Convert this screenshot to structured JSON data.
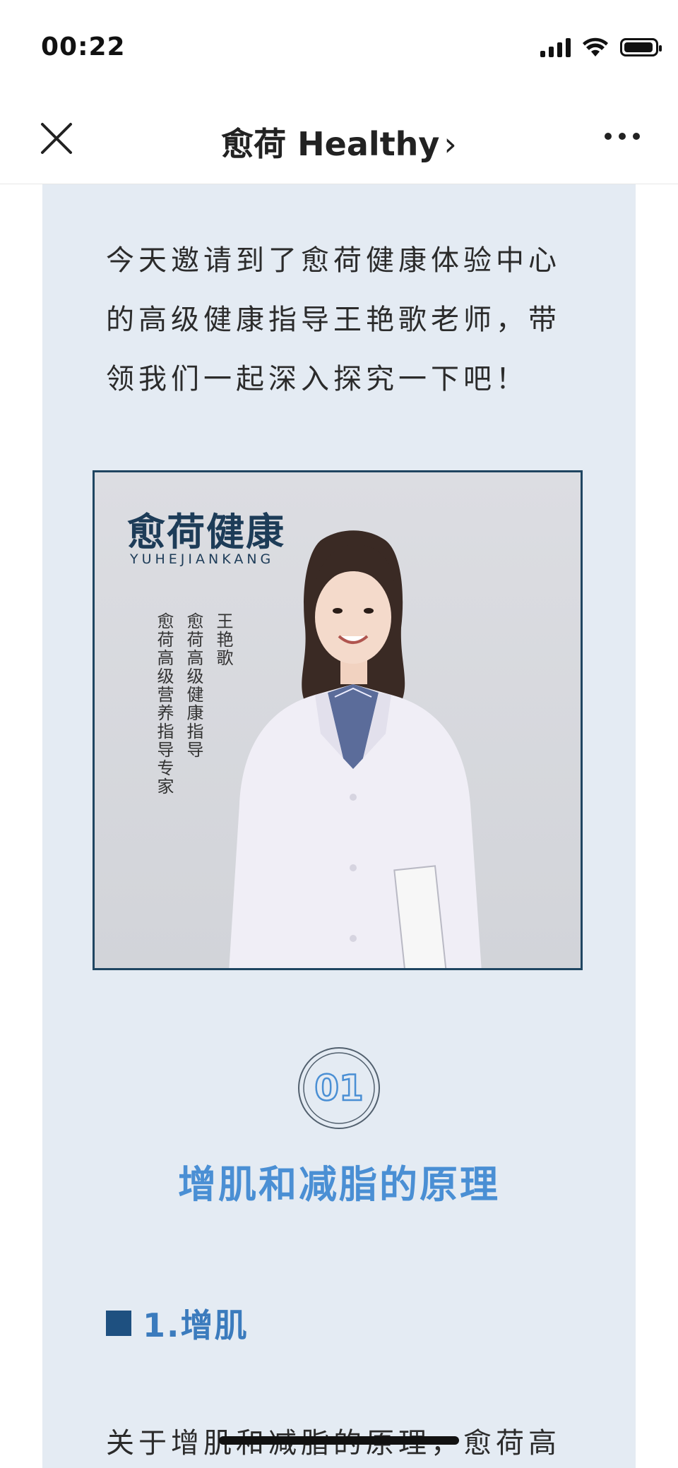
{
  "status": {
    "time": "00:22"
  },
  "nav": {
    "title": "愈荷 Healthy",
    "arrow": "›"
  },
  "intro_text": "今天邀请到了愈荷健康体验中心的高级健康指导王艳歌老师，带领我们一起深入探究一下吧！",
  "photo": {
    "logo": "愈荷健康",
    "logo_sub": "YUHEJIANKANG",
    "name": "王艳歌",
    "role1": "愈荷高级健康指导",
    "role2": "愈荷高级营养指导专家"
  },
  "section": {
    "number": "01",
    "title": "增肌和减脂的原理"
  },
  "subheading": "1.增肌",
  "body_text": "关于增肌和减脂的原理，愈荷高",
  "colors": {
    "accent_blue": "#4a8fd4",
    "dark_blue": "#1e5080",
    "article_bg": "#e4ebf3"
  }
}
